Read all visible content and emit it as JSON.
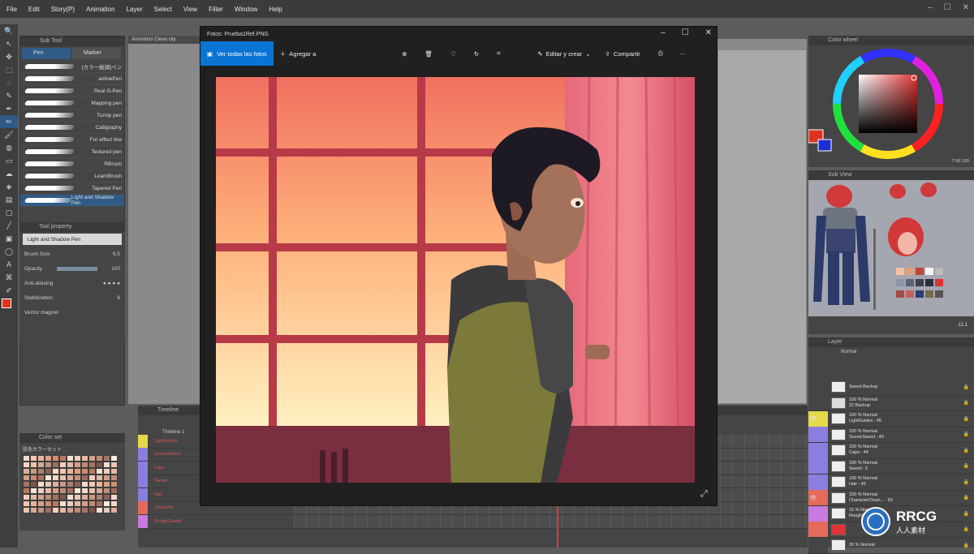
{
  "menu": [
    "File",
    "Edit",
    "Story(P)",
    "Animation",
    "Layer",
    "Select",
    "View",
    "Filter",
    "Window",
    "Help"
  ],
  "subtool": {
    "tabs": [
      "Pen",
      "Marker"
    ],
    "brushes": [
      "[カラー絵調]ペン",
      "anlinePen",
      "Real G-Pen",
      "Mapping pen",
      "Turnip pen",
      "Calligraphy",
      "For effect line",
      "Textured pen",
      "RBrush",
      "LearnBrush",
      "Tapered Pen",
      "Light and Shadow Pen"
    ],
    "selected": 11
  },
  "toolprop": {
    "name": "Light and Shadow Pen",
    "brush_size_label": "Brush Size",
    "brush_size": "6.5",
    "opacity_label": "Opacity",
    "opacity": "100",
    "anti_label": "Anti-aliasing",
    "stab_label": "Stabilization",
    "stab": "6",
    "vector_label": "Vector magnet"
  },
  "viewer": {
    "title": "Fotos: Prueba1Ref.PNG",
    "all_photos": "Ver todas las fotos",
    "add": "Agregar a",
    "edit": "Editar y crear",
    "share": "Compartir"
  },
  "layers": [
    {
      "l1": "Sword Backup",
      "l2": "",
      "color": "#454545",
      "eye": "",
      "thumb": "#eee"
    },
    {
      "l1": "100 % Normal",
      "l2": "22 Backup",
      "color": "#454545",
      "eye": "",
      "thumb": "#ddd"
    },
    {
      "l1": "100 % Normal",
      "l2": "LightGuides : 45",
      "color": "#e5d94a",
      "eye": "👁",
      "thumb": "#eee"
    },
    {
      "l1": "100 % Normal",
      "l2": "ScenicSword : 40",
      "color": "#8a7fe0",
      "eye": "",
      "thumb": "#eee"
    },
    {
      "l1": "100 % Normal",
      "l2": "Cape : 44",
      "color": "#8a7fe0",
      "eye": "",
      "thumb": "#eee"
    },
    {
      "l1": "100 % Normal",
      "l2": "Sword : 5",
      "color": "#8a7fe0",
      "eye": "",
      "thumb": "#eee"
    },
    {
      "l1": "100 % Normal",
      "l2": "Hair : 45",
      "color": "#8a7fe0",
      "eye": "",
      "thumb": "#eee"
    },
    {
      "l1": "100 % Normal",
      "l2": "CharacterClean... : 50",
      "color": "#e56a5a",
      "eye": "👁",
      "thumb": "#eee"
    },
    {
      "l1": "15 % Normal",
      "l2": "RoughGuides",
      "color": "#c77ae0",
      "eye": "",
      "thumb": "#eee"
    },
    {
      "l1": "",
      "l2": "",
      "color": "#e56a5a",
      "eye": "",
      "thumb": "#d33"
    },
    {
      "l1": "20 % Normal",
      "l2": "",
      "color": "#454545",
      "eye": "",
      "thumb": "#eee"
    }
  ],
  "timeline": {
    "title": "Timeline",
    "track": "Timeline 1",
    "tracks": [
      {
        "name": "LightGuides",
        "color": "#e5d94a"
      },
      {
        "name": "ScenicSword",
        "color": "#8a7fe0"
      },
      {
        "name": "Cape",
        "color": "#8a7fe0"
      },
      {
        "name": "Sword",
        "color": "#8a7fe0"
      },
      {
        "name": "Hair",
        "color": "#8a7fe0"
      },
      {
        "name": "Character",
        "color": "#e56a5a"
      },
      {
        "name": "RoughGuides",
        "color": "#c77ae0"
      }
    ]
  },
  "subview_zoom": "12.1",
  "colorwheel_readout": "7 95 100",
  "colorset_title": "Color set",
  "colorset_name": "肌色カラーセット",
  "watermark": {
    "brand": "RRCG",
    "sub": "人人素材"
  },
  "colors": {
    "accent": "#2f5b86",
    "photos_blue": "#0a74d4",
    "main": "#e0321e",
    "sub": "#1b2fd6"
  }
}
